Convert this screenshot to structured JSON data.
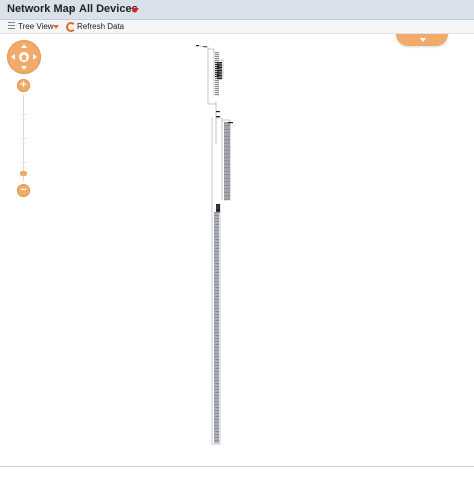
{
  "header": {
    "root": "Network Map",
    "separator": "›",
    "current": "All Devices",
    "accent_color": "#e02020"
  },
  "toolbar": {
    "view_label": "Tree View",
    "refresh_label": "Refresh Data",
    "icon_view": "list-icon",
    "icon_refresh": "refresh-icon",
    "icon_color": "#e76a1a"
  },
  "map_controls": {
    "zoom_in": "+",
    "zoom_out": "−",
    "control_color": "#f0aa6a"
  }
}
